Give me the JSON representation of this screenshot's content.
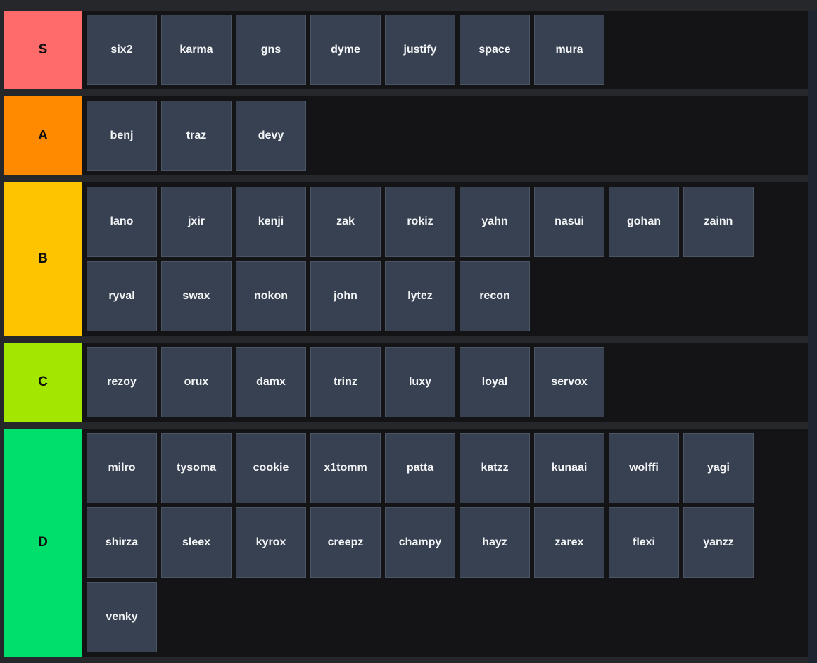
{
  "tiers": [
    {
      "label": "S",
      "color": "#ff6b6b",
      "items": [
        "six2",
        "karma",
        "gns",
        "dyme",
        "justify",
        "space",
        "mura"
      ]
    },
    {
      "label": "A",
      "color": "#ff8a00",
      "items": [
        "benj",
        "traz",
        "devy"
      ]
    },
    {
      "label": "B",
      "color": "#ffc400",
      "items": [
        "lano",
        "jxir",
        "kenji",
        "zak",
        "rokiz",
        "yahn",
        "nasui",
        "gohan",
        "zainn",
        "ryval",
        "swax",
        "nokon",
        "john",
        "lytez",
        "recon"
      ]
    },
    {
      "label": "C",
      "color": "#a3e600",
      "items": [
        "rezoy",
        "orux",
        "damx",
        "trinz",
        "luxy",
        "loyal",
        "servox"
      ]
    },
    {
      "label": "D",
      "color": "#00de6c",
      "items": [
        "milro",
        "tysoma",
        "cookie",
        "x1tomm",
        "patta",
        "katzz",
        "kunaai",
        "wolffi",
        "yagi",
        "shirza",
        "sleex",
        "kyrox",
        "creepz",
        "champy",
        "hayz",
        "zarex",
        "flexi",
        "yanzz",
        "venky"
      ]
    }
  ]
}
